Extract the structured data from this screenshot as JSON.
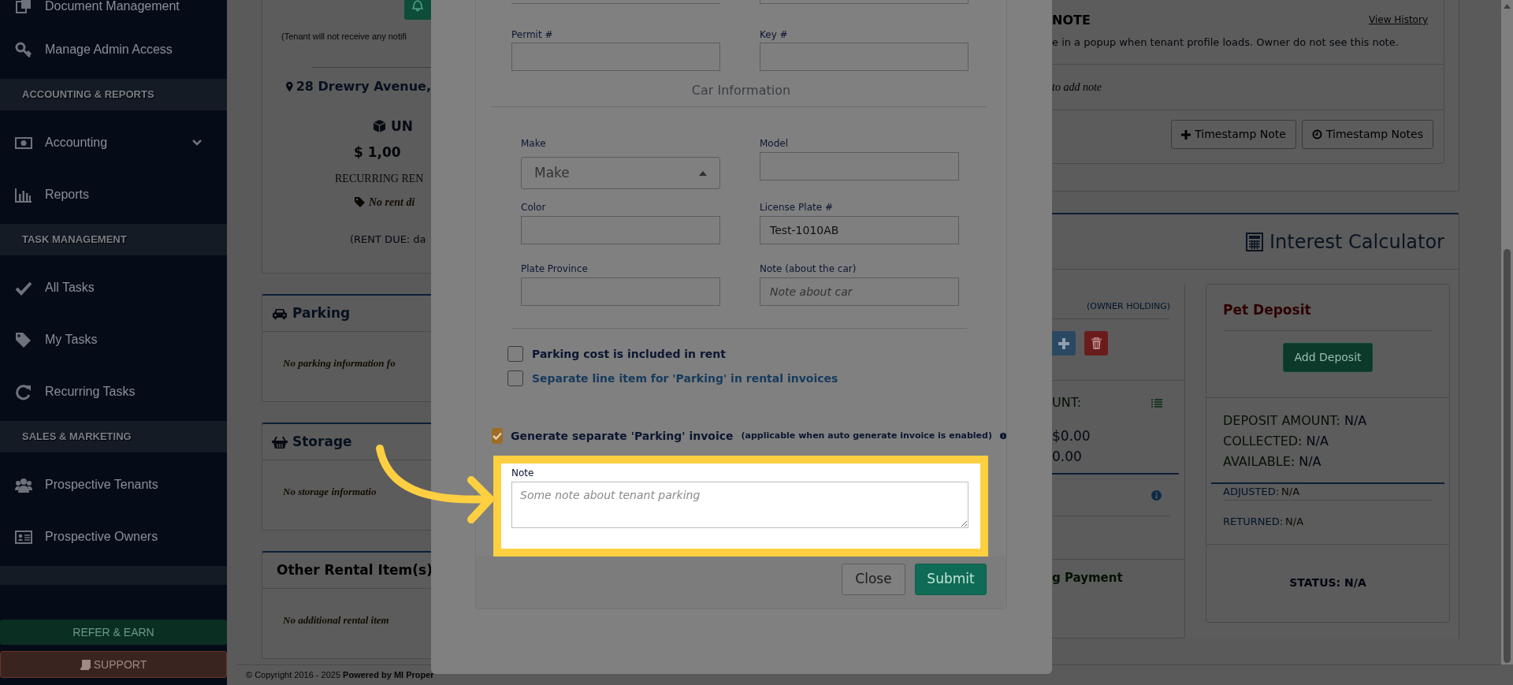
{
  "sidebar": {
    "items": [
      {
        "kind": "link",
        "label": "Document Management",
        "submenu": false
      },
      {
        "kind": "link",
        "label": "Manage Admin Access",
        "submenu": false
      },
      {
        "kind": "header",
        "label": "ACCOUNTING & REPORTS"
      },
      {
        "kind": "link",
        "label": "Accounting",
        "submenu": true
      },
      {
        "kind": "link",
        "label": "Reports",
        "submenu": false
      },
      {
        "kind": "header",
        "label": "TASK MANAGEMENT"
      },
      {
        "kind": "link",
        "label": "All Tasks",
        "submenu": false
      },
      {
        "kind": "link",
        "label": "My Tasks",
        "submenu": false
      },
      {
        "kind": "link",
        "label": "Recurring Tasks",
        "submenu": false
      },
      {
        "kind": "header",
        "label": "SALES & MARKETING"
      },
      {
        "kind": "link",
        "label": "Prospective Tenants",
        "submenu": false
      },
      {
        "kind": "link",
        "label": "Prospective Owners",
        "submenu": false
      }
    ],
    "refer_button": "REFER & EARN",
    "support_button": "SUPPORT"
  },
  "tenant_card": {
    "notice": "(Tenant will not receive any notifi",
    "address": "28 Drewry Avenue,",
    "unit": "UN",
    "amount": "$ 1,00",
    "recurring": "RECURRING REN",
    "discount": "No rent di",
    "rent_due": "(RENT DUE: da"
  },
  "panels": [
    {
      "title": "Parking",
      "message": "No parking information fo"
    },
    {
      "title": "Storage",
      "message": "No storage informatio"
    },
    {
      "title": "Other Rental Item(s)",
      "message": "No additional rental item"
    }
  ],
  "footer": "© Copyright 2016 - 2025 **Powered by MI Proper**",
  "note_card": {
    "title": "NOTE",
    "history_link": "View History",
    "description": "e in a popup when tenant profile loads. Owner do not see this note.",
    "empty": "to add note",
    "buttons": [
      "Timestamp Note",
      "Timestamp Notes"
    ]
  },
  "interest_calculator": {
    "title": "Interest Calculator",
    "holding_card": {
      "tag": "(OWNER HOLDING)",
      "amount_label": "UNT:",
      "amounts": [
        "$0.00",
        "0.00"
      ],
      "payment": "g Payment"
    },
    "pet_deposit": {
      "title": "Pet Deposit",
      "button": "Add Deposit",
      "stats": [
        {
          "label": "DEPOSIT AMOUNT:",
          "value": "N/A"
        },
        {
          "label": "COLLECTED:",
          "value": "N/A"
        },
        {
          "label": "AVAILABLE:",
          "value": "N/A"
        }
      ],
      "details": [
        {
          "label": "ADJUSTED:",
          "value": "N/A"
        },
        {
          "label": "RETURNED:",
          "value": "N/A"
        }
      ],
      "status": "STATUS: N/A"
    }
  },
  "modal": {
    "top_fields": [
      {
        "label": "Permit #"
      },
      {
        "label": "Key #"
      }
    ],
    "section_title": "Car Information",
    "car_fields": [
      {
        "kind": "select",
        "label": "Make",
        "placeholder": "Make"
      },
      {
        "kind": "input",
        "label": "Model"
      },
      {
        "kind": "input",
        "label": "Color"
      },
      {
        "kind": "input",
        "label": "License Plate #",
        "value": "Test-1010AB"
      },
      {
        "kind": "input",
        "label": "Plate Province"
      },
      {
        "kind": "input",
        "label": "Note (about the car)",
        "placeholder": "Note about car"
      }
    ],
    "checkboxes": [
      {
        "kind": "plain",
        "label": "Parking cost is included in rent",
        "checked": false
      },
      {
        "kind": "link",
        "label": "Separate line item for 'Parking' in rental invoices",
        "checked": false
      }
    ],
    "invoice_option": {
      "label": "Generate separate 'Parking' invoice",
      "hint": "(applicable when auto generate invoice is enabled)",
      "checked": true
    },
    "note": {
      "label": "Note",
      "placeholder": "Some note about tenant parking"
    },
    "buttons": [
      {
        "kind": "secondary",
        "label": "Close"
      },
      {
        "kind": "primary",
        "label": "Submit"
      }
    ]
  }
}
